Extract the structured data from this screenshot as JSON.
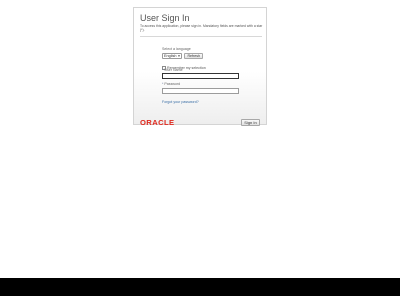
{
  "login": {
    "title": "User Sign In",
    "intro": "To access this application, please sign in. Mandatory fields are marked with a star (*).",
    "language_label": "Select a language",
    "language_value": "English",
    "refresh_label": "Refresh",
    "remember_label": "Remember my selection",
    "required_marker": "*",
    "username_label": "User Name",
    "username_value": "",
    "password_label": "Password",
    "password_value": "",
    "forgot_link": "Forgot your password?",
    "logo_text": "ORACLE",
    "sign_in_label": "Sign In"
  },
  "colors": {
    "brand": "#e0281d",
    "link": "#3a6ea5",
    "taskbar": "#000000"
  }
}
